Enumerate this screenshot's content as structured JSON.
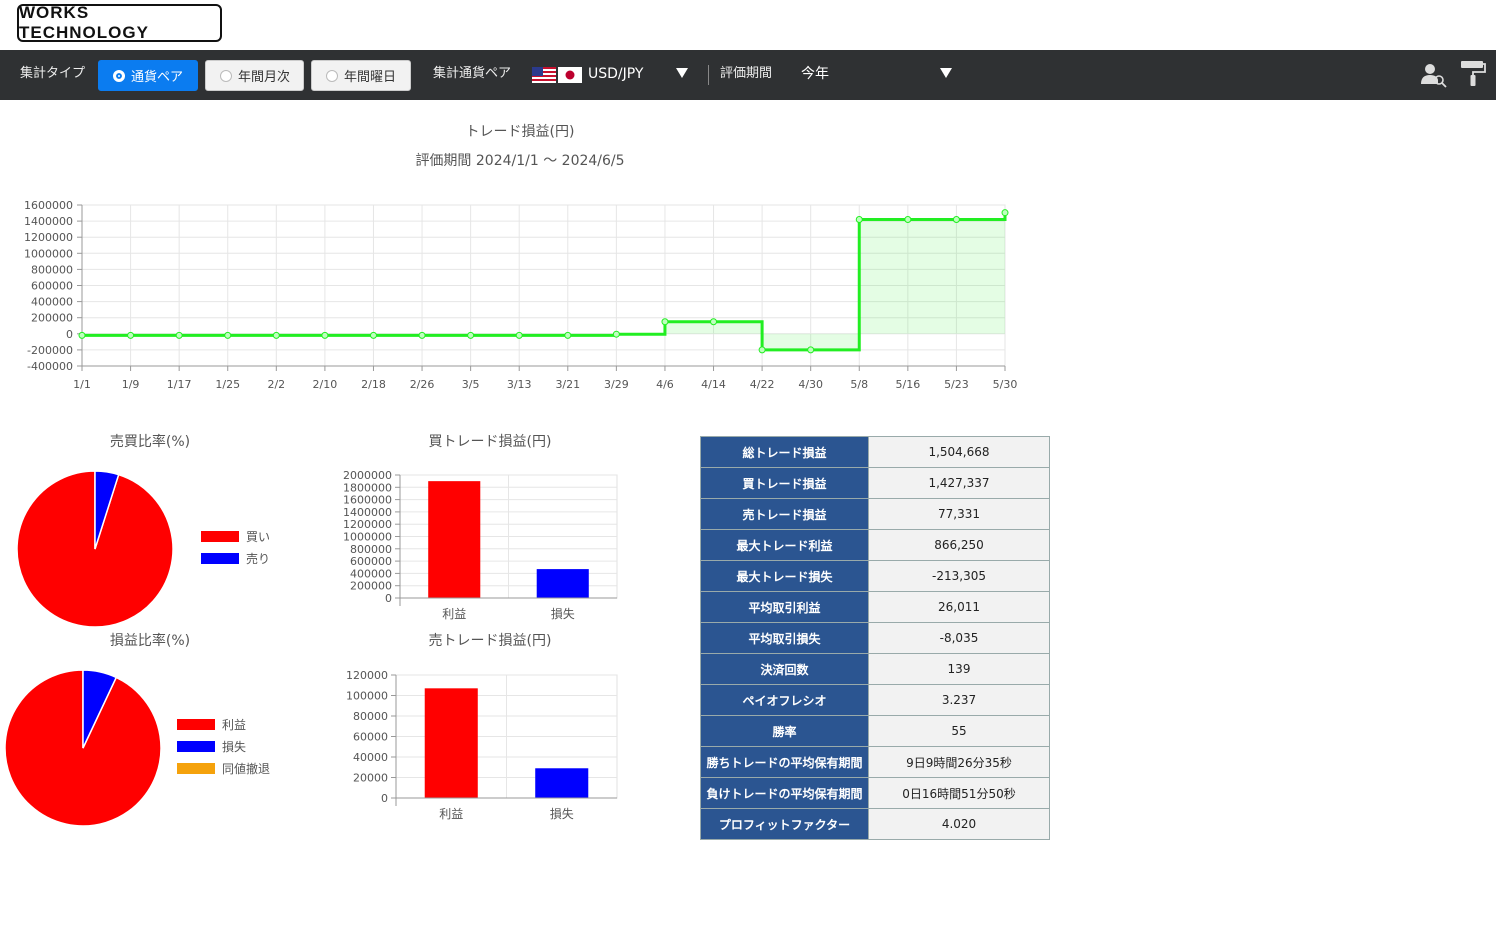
{
  "brand": {
    "logo_text": "WORKS TECHNOLOGY"
  },
  "toolbar": {
    "agg_type_label": "集計タイプ",
    "agg_options": [
      {
        "label": "通貨ペア",
        "selected": true
      },
      {
        "label": "年間月次",
        "selected": false
      },
      {
        "label": "年間曜日",
        "selected": false
      }
    ],
    "pair_label": "集計通貨ペア",
    "pair_value": "USD/JPY",
    "period_label": "評価期間",
    "period_value": "今年",
    "icons": [
      "user-search-icon",
      "paint-roller-icon"
    ]
  },
  "colors": {
    "toolbar_bg": "#2f3133",
    "active_blue": "#0b7cf0",
    "line_green": "#22ee22",
    "red": "#ff0000",
    "blue": "#0000ff",
    "orange": "#f5a20c",
    "table_header": "#2b5591"
  },
  "chart_data": [
    {
      "id": "pnl_line",
      "type": "line",
      "title": "トレード損益(円)",
      "subtitle": "評価期間  2024/1/1 ～ 2024/6/5",
      "stepped": true,
      "x": [
        "1/1",
        "1/9",
        "1/17",
        "1/25",
        "2/2",
        "2/10",
        "2/18",
        "2/26",
        "3/5",
        "3/13",
        "3/21",
        "3/29",
        "4/6",
        "4/14",
        "4/22",
        "4/30",
        "5/8",
        "5/16",
        "5/23",
        "5/30"
      ],
      "y": [
        -20000,
        -20000,
        -20000,
        -20000,
        -20000,
        -20000,
        -20000,
        -20000,
        -20000,
        -20000,
        -20000,
        -5000,
        150000,
        150000,
        -200000,
        -200000,
        1420000,
        1420000,
        1420000,
        1504668
      ],
      "ylim": [
        -400000,
        1600000
      ],
      "yticks": [
        1600000,
        1400000,
        1200000,
        1000000,
        800000,
        600000,
        400000,
        200000,
        0,
        -200000,
        -400000
      ],
      "grid": true,
      "fill": true
    },
    {
      "id": "buy_sell_ratio",
      "type": "pie",
      "title": "売買比率(%)",
      "labels": [
        "買い",
        "売り"
      ],
      "values": [
        95.1,
        4.9
      ],
      "colors": [
        "#ff0000",
        "#0000ff"
      ],
      "legend": "right"
    },
    {
      "id": "pl_ratio",
      "type": "pie",
      "title": "損益比率(%)",
      "labels": [
        "利益",
        "損失",
        "同値撤退"
      ],
      "values": [
        93,
        7,
        0
      ],
      "colors": [
        "#ff0000",
        "#0000ff",
        "#f5a20c"
      ],
      "legend": "right"
    },
    {
      "id": "buy_trade_pnl",
      "type": "bar",
      "title": "買トレード損益(円)",
      "categories": [
        "利益",
        "損失"
      ],
      "values": [
        1900000,
        470000
      ],
      "colors": [
        "#ff0000",
        "#0000ff"
      ],
      "ylim": [
        0,
        2000000
      ],
      "yticks": [
        2000000,
        1800000,
        1600000,
        1400000,
        1200000,
        1000000,
        800000,
        600000,
        400000,
        200000,
        0
      ]
    },
    {
      "id": "sell_trade_pnl",
      "type": "bar",
      "title": "売トレード損益(円)",
      "categories": [
        "利益",
        "損失"
      ],
      "values": [
        107000,
        29000
      ],
      "colors": [
        "#ff0000",
        "#0000ff"
      ],
      "ylim": [
        0,
        120000
      ],
      "yticks": [
        120000,
        100000,
        80000,
        60000,
        40000,
        20000,
        0
      ]
    }
  ],
  "stats": [
    {
      "label": "総トレード損益",
      "value": "1,504,668"
    },
    {
      "label": "買トレード損益",
      "value": "1,427,337"
    },
    {
      "label": "売トレード損益",
      "value": "77,331"
    },
    {
      "label": "最大トレード利益",
      "value": "866,250"
    },
    {
      "label": "最大トレード損失",
      "value": "-213,305"
    },
    {
      "label": "平均取引利益",
      "value": "26,011"
    },
    {
      "label": "平均取引損失",
      "value": "-8,035"
    },
    {
      "label": "決済回数",
      "value": "139"
    },
    {
      "label": "ペイオフレシオ",
      "value": "3.237"
    },
    {
      "label": "勝率",
      "value": "55"
    },
    {
      "label": "勝ちトレードの平均保有期間",
      "value": "9日9時間26分35秒"
    },
    {
      "label": "負けトレードの平均保有期間",
      "value": "0日16時間51分50秒"
    },
    {
      "label": "プロフィットファクター",
      "value": "4.020"
    }
  ]
}
